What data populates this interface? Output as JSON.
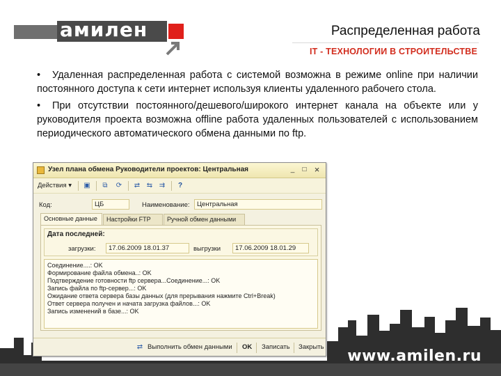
{
  "header": {
    "logo_text": "амилен",
    "title": "Распределенная работа",
    "subtitle": "IT - ТЕХНОЛОГИИ В СТРОИТЕЛЬСТВЕ"
  },
  "bullets": [
    {
      "marker": "•",
      "text": "Удаленная распределенная работа с системой возможна в режиме online при наличии постоянного доступа к сети интернет используя клиенты удаленного рабочего стола."
    },
    {
      "marker": "•",
      "text": "При отсутствии постоянного/дешевого/широкого интернет канала на объекте или у руководителя проекта возможна offline работа удаленных пользователей с использованием периодического автоматического обмена данными по ftp."
    }
  ],
  "window": {
    "title": "Узел плана обмена Руководители проектов: Центральная",
    "controls": {
      "minimize": "_",
      "maximize": "□",
      "close": "×"
    },
    "toolbar": {
      "actions_label": "Действия ▾",
      "help": "?"
    },
    "fields": {
      "code_label": "Код:",
      "code_value": "ЦБ",
      "name_label": "Наименование:",
      "name_value": "Центральная"
    },
    "tabs": [
      "Основные данные",
      "Настройки FTP",
      "Ручной обмен данными"
    ],
    "group": {
      "title": "Дата последней:",
      "download_label": "загрузки:",
      "download_value": "17.06.2009 18.01.37",
      "upload_label": "выгрузки",
      "upload_value": "17.06.2009 18.01.29"
    },
    "log": [
      "Соединение....: OK",
      "Формирование файла обмена..: OK",
      "Подтверждение готовности ftp сервера...Соединение...: OK",
      "Запись файла по ftp-сервер...: OK",
      "Ожидание ответа сервера базы данных (для прерывания нажмите Ctrl+Break)",
      "Ответ сервера получен и начата загрузка файлов...: OK",
      "Запись изменений в базе...: OK"
    ],
    "bottom_buttons": {
      "exchange": "Выполнить обмен данными",
      "ok": "OK",
      "save": "Записать",
      "close": "Закрыть"
    }
  },
  "footer": {
    "url": "www.amilen.ru"
  },
  "colors": {
    "accent_red": "#d22d1e",
    "logo_dark": "#4a4a4a",
    "dialog_bg": "#f4f1e0",
    "skyline": "#2e2e2e"
  }
}
